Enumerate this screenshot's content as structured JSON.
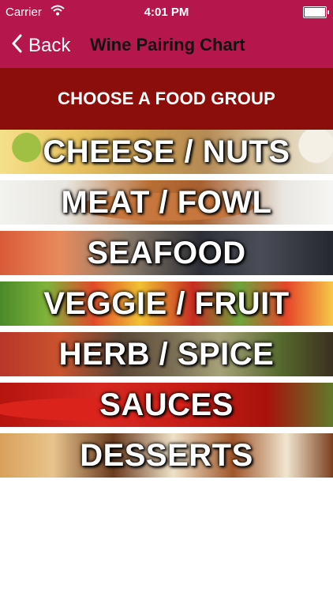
{
  "status_bar": {
    "carrier": "Carrier",
    "time": "4:01 PM"
  },
  "nav": {
    "back_label": "Back",
    "title": "Wine Pairing Chart"
  },
  "header": {
    "text": "CHOOSE A FOOD GROUP"
  },
  "food_groups": [
    {
      "label": "CHEESE / NUTS"
    },
    {
      "label": "MEAT / FOWL"
    },
    {
      "label": "SEAFOOD"
    },
    {
      "label": "VEGGIE / FRUIT"
    },
    {
      "label": "HERB / SPICE"
    },
    {
      "label": "SAUCES"
    },
    {
      "label": "DESSERTS"
    }
  ],
  "colors": {
    "nav_bar": "#b5174d",
    "header_band": "#8c0e0b"
  }
}
